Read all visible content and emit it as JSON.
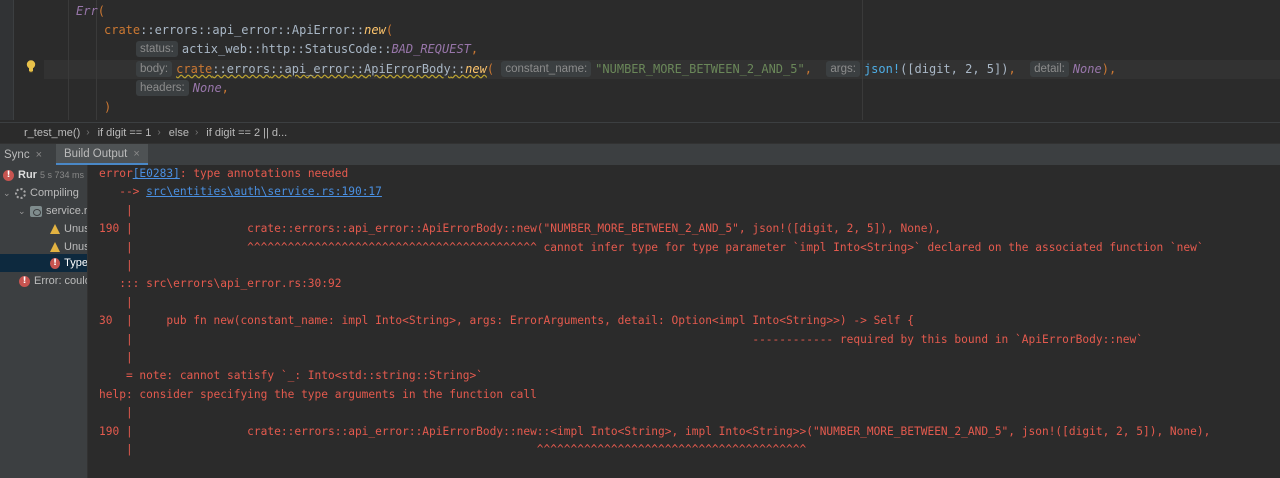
{
  "editor": {
    "lines": {
      "l1": {
        "err": "Err",
        "paren": "("
      },
      "l2": {
        "path1": "crate",
        "sep1": "::",
        "path2": "errors",
        "sep2": "::",
        "path3": "api_error",
        "sep3": "::",
        "type": "ApiError",
        "sep4": "::",
        "fn": "new",
        "paren": "("
      },
      "l3": {
        "hint": "status:",
        "t1": "actix_web",
        "s1": "::",
        "t2": "http",
        "s2": "::",
        "t3": "StatusCode",
        "s3": "::",
        "const": "BAD_REQUEST",
        "comma": ","
      },
      "l4": {
        "hint": "body:",
        "p1": "crate",
        "s1": "::",
        "p2": "errors",
        "s2": "::",
        "p3": "api_error",
        "s3": "::",
        "type": "ApiErrorBody",
        "s4": "::",
        "fn": "new",
        "open": "(",
        "hint2": "constant_name:",
        "str": "\"NUMBER_MORE_BETWEEN_2_AND_5\"",
        "c1": ",",
        "hint3": "args:",
        "macro": "json!",
        "macroargs": "([digit, 2, 5])",
        "c2": ",",
        "hint4": "detail:",
        "none": "None",
        "close": "),"
      },
      "l5": {
        "hint": "headers:",
        "none": "None",
        "comma": ","
      },
      "l6": {
        "paren": ")"
      }
    }
  },
  "breadcrumb": [
    "r_test_me()",
    "if digit == 1",
    "else",
    "if digit == 2 || d..."
  ],
  "tooltabs": [
    {
      "label": "Sync",
      "close": "×"
    },
    {
      "label": "Build Output",
      "close": "×"
    }
  ],
  "tree": {
    "run_label": "Rur",
    "run_time": "5 s 734 ms",
    "compiling": "Compiling",
    "file": "service.r",
    "warn1": "Unus",
    "warn2": "Unus",
    "type_err": "Type",
    "error_label": "Error: could"
  },
  "output": {
    "l01a": "error",
    "l01b": "[E0283]",
    "l01c": ": type annotations needed",
    "l02a": "   --> ",
    "l02b": "src\\entities\\auth\\service.rs:190:17",
    "l03": "    |",
    "l04": "190 |                 crate::errors::api_error::ApiErrorBody::new(\"NUMBER_MORE_BETWEEN_2_AND_5\", json!([digit, 2, 5]), None),",
    "l05": "    |                 ^^^^^^^^^^^^^^^^^^^^^^^^^^^^^^^^^^^^^^^^^^^ cannot infer type for type parameter `impl Into<String>` declared on the associated function `new`",
    "l06": "    |",
    "l07": "   ::: src\\errors\\api_error.rs:30:92",
    "l08": "    |",
    "l09": "30  |     pub fn new(constant_name: impl Into<String>, args: ErrorArguments, detail: Option<impl Into<String>>) -> Self {",
    "l10": "    |                                                                                            ------------ required by this bound in `ApiErrorBody::new`",
    "l11": "    |",
    "l12": "    = note: cannot satisfy `_: Into<std::string::String>`",
    "l13": "help: consider specifying the type arguments in the function call",
    "l14": "    |",
    "l15": "190 |                 crate::errors::api_error::ApiErrorBody::new::<impl Into<String>, impl Into<String>>(\"NUMBER_MORE_BETWEEN_2_AND_5\", json!([digit, 2, 5]), None),",
    "l16": "    |                                                            ^^^^^^^^^^^^^^^^^^^^^^^^^^^^^^^^^^^^^^^^"
  }
}
